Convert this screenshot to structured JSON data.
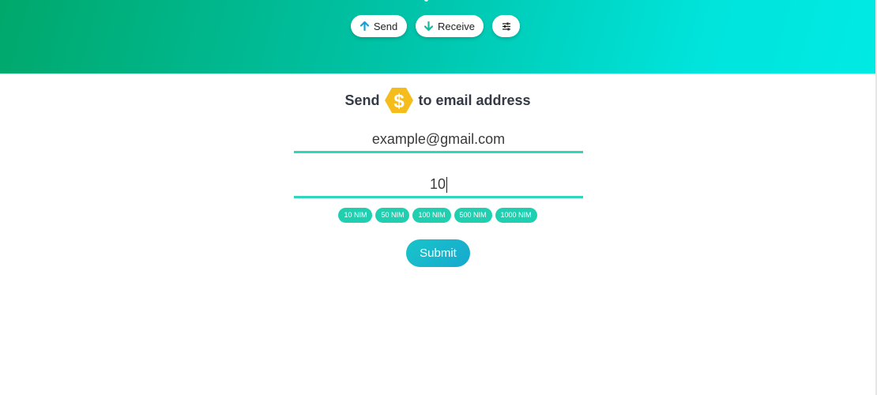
{
  "header": {
    "send_label": "Send",
    "receive_label": "Receive",
    "send_icon": "arrow-up-icon",
    "receive_icon": "arrow-down-icon",
    "settings_icon": "sliders-icon",
    "gradient": [
      "#00a86b",
      "#00eae4"
    ]
  },
  "form": {
    "title_prefix": "Send",
    "title_suffix": "to email address",
    "coin_icon": "nim-coin-icon",
    "email_value": "example@gmail.com",
    "amount_value": "10",
    "quick_amounts": [
      "10 NIM",
      "50 NIM",
      "100 NIM",
      "500 NIM",
      "1000 NIM"
    ],
    "submit_label": "Submit"
  },
  "colors": {
    "accent": "#2fd6b9",
    "chip": "#1fcfb0",
    "submit": "#17a9cf",
    "coin": "#f5bd1c"
  }
}
